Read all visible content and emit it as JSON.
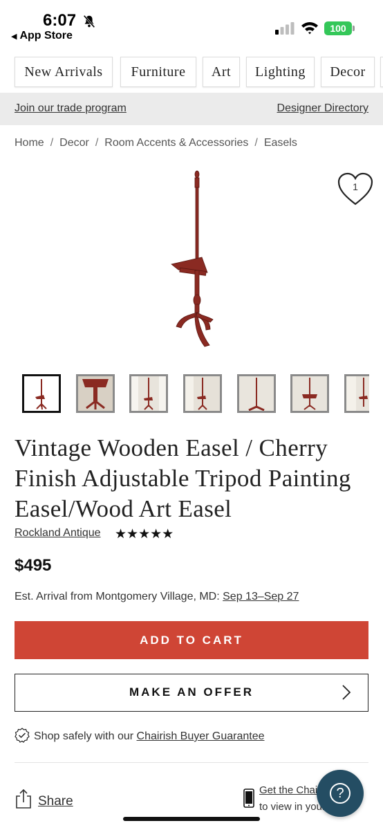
{
  "status": {
    "time": "6:07",
    "back_label": "App Store",
    "battery": "100",
    "battery_color": "#34c759"
  },
  "nav": {
    "categories": [
      "New Arrivals",
      "Furniture",
      "Art",
      "Lighting",
      "Decor"
    ]
  },
  "trade_bar": {
    "join_label": "Join our trade program",
    "directory_label": "Designer Directory"
  },
  "breadcrumb": [
    "Home",
    "Decor",
    "Room Accents & Accessories",
    "Easels"
  ],
  "favorite": {
    "count": "1",
    "icon": "heart-icon"
  },
  "thumbnails_count": 7,
  "product": {
    "title": "Vintage Wooden Easel / Cherry Finish Adjustable Tripod Painting Easel/Wood Art Easel",
    "seller": "Rockland Antique",
    "rating_stars": "★★★★★",
    "rating": 5,
    "price": "$495",
    "arrival_prefix": "Est. Arrival from Montgomery Village, MD: ",
    "arrival_dates": "Sep 13–Sep 27"
  },
  "actions": {
    "add_to_cart": "ADD TO CART",
    "make_offer": "MAKE AN OFFER"
  },
  "guarantee": {
    "prefix": "Shop safely with our ",
    "link": "Chairish Buyer Guarantee"
  },
  "share": {
    "label": "Share"
  },
  "get_app": {
    "line1": "Get the Chairish app",
    "line2": "to view in your space"
  },
  "colors": {
    "accent_red": "#cf4535",
    "help_blue": "#244d63",
    "wood": "#8a2a22"
  }
}
